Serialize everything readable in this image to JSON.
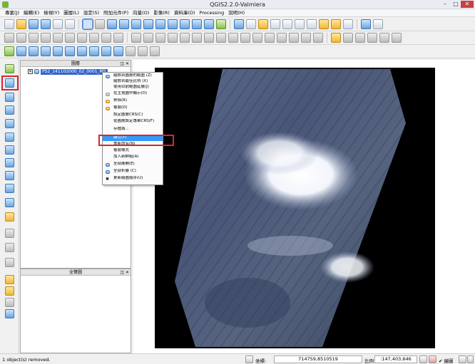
{
  "window": {
    "title": "QGIS2.2.0-Valmiera",
    "minimize": "–",
    "maximize": "□",
    "close": "✕"
  },
  "menu": [
    "專案(J)",
    "編輯(E)",
    "檢視(Y)",
    "圖層(L)",
    "設定(S)",
    "附加元件(P)",
    "向量(O)",
    "影像(R)",
    "資料庫(D)",
    "Processing",
    "說明(H)"
  ],
  "layers_panel": {
    "title": "圖層",
    "buttons": "◫ ✕",
    "layer": {
      "checked": "✕",
      "name": "PS2_141102000_02_0001_MS"
    }
  },
  "context_menu": {
    "items": [
      {
        "label": "縮放到圖層的範圍 (Z)",
        "icon": "zoom-layer-icon",
        "highlighted": false
      },
      {
        "label": "縮放到最佳比例 (X)",
        "icon": "",
        "highlighted": false
      },
      {
        "label": "使用目前範圍延展(J)",
        "icon": "",
        "highlighted": false
      },
      {
        "label": "在主覽圖中顯示(O)",
        "icon": "overview-checkbox-icon",
        "highlighted": false
      },
      {
        "label": "移除(R)",
        "icon": "remove-icon",
        "highlighted": false
      },
      {
        "label": "複製(D)",
        "icon": "duplicate-icon",
        "highlighted": false
      },
      {
        "label": "設定圖層CRS(C)",
        "icon": "",
        "highlighted": false
      },
      {
        "label": "從圖層設定專案CRS(F)",
        "icon": "",
        "highlighted": false
      },
      {
        "label": "存檔為...",
        "icon": "",
        "highlighted": false
      },
      {
        "label": "屬性(P)",
        "icon": "",
        "highlighted": true
      },
      {
        "label": "重新命名(N)",
        "icon": "",
        "highlighted": false
      },
      {
        "label": "複製樣式",
        "icon": "",
        "highlighted": false
      },
      {
        "label": "加入新群組(A)",
        "icon": "",
        "highlighted": false
      },
      {
        "label": "全部展開(E)",
        "icon": "expand-all-icon",
        "highlighted": false
      },
      {
        "label": "全部折疊 (C)",
        "icon": "collapse-all-icon",
        "highlighted": false
      },
      {
        "label": "更新繪圖順序(U)",
        "icon": "update-order-icon",
        "highlighted": false
      }
    ]
  },
  "overview_panel": {
    "title": "全覽圖",
    "buttons": "◫ ✕"
  },
  "statusbar": {
    "message": "1 object(s) removed.",
    "coord_label": "坐標:",
    "coord_value": "714759,8510519",
    "scale_label": "比例",
    "scale_value": ":147,403,646",
    "render_label": "✔ 繪圖"
  },
  "colors": {
    "highlight": "#3399ff",
    "annotation_red": "#d8262a",
    "layer_select": "#3366cc"
  }
}
